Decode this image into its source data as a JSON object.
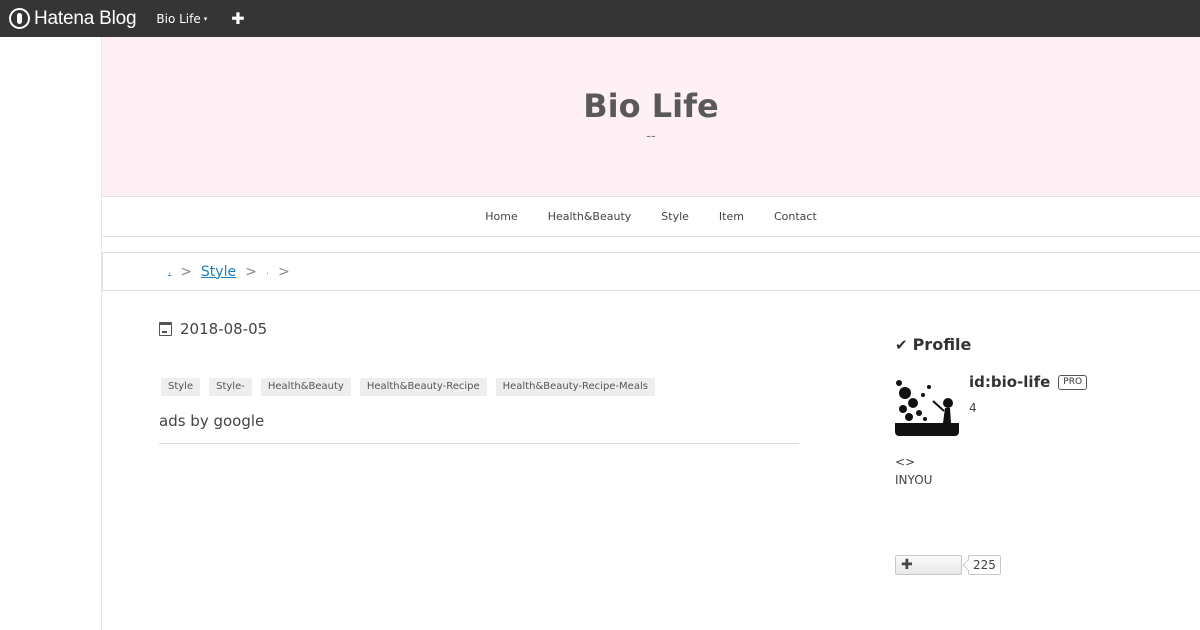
{
  "topbar": {
    "logo_text": "Hatena Blog",
    "blog_menu_label": "Bio Life",
    "caret": "▾",
    "plus": "✚"
  },
  "header": {
    "title": "Bio Life",
    "description": "--"
  },
  "nav": {
    "items": [
      "Home",
      "Health&Beauty",
      "Style",
      "Item",
      "Contact"
    ]
  },
  "breadcrumb": {
    "first": ".",
    "sep": ">",
    "middle": "Style",
    "last": "."
  },
  "entry": {
    "date": "2018-08-05",
    "tags": [
      "Style",
      "Style-",
      "Health&Beauty",
      "Health&Beauty-Recipe",
      "Health&Beauty-Recipe-Meals"
    ],
    "ads_text": "ads by google"
  },
  "profile": {
    "title": "Profile",
    "id": "id:bio-life",
    "badge": "PRO",
    "count": "4",
    "arrows": "<>",
    "inyou": "INYOU",
    "follow_icon": "✚",
    "follow_count": "225"
  }
}
